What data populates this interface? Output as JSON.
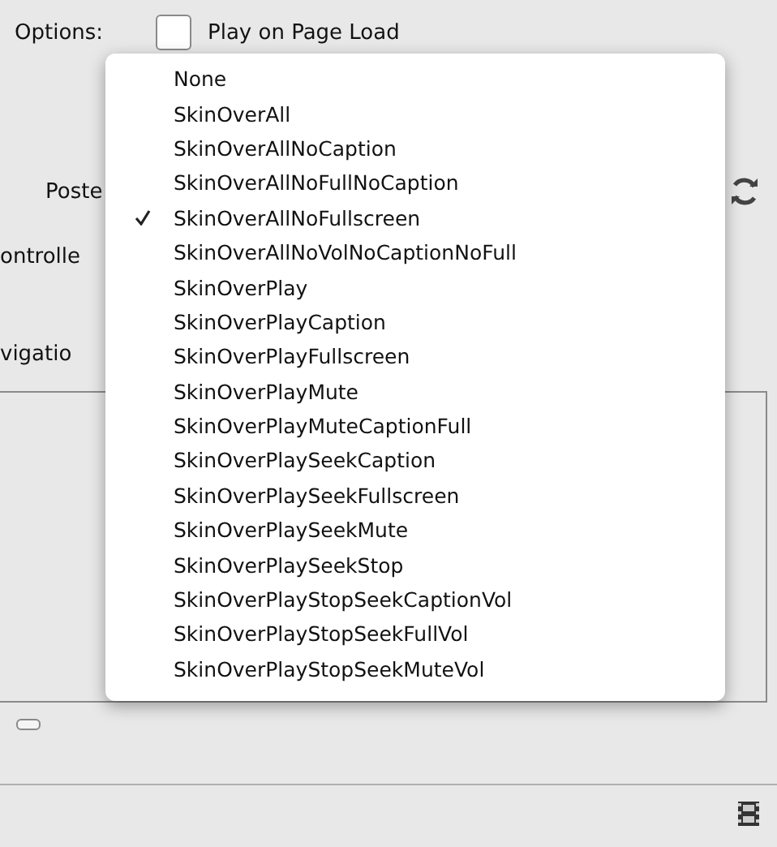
{
  "options": {
    "label": "Options:",
    "play_on_load": {
      "label": "Play on Page Load",
      "checked": false
    }
  },
  "side_labels": [
    {
      "text": "Poste",
      "kind": "poster"
    },
    {
      "text": "ontrolle",
      "kind": "controller"
    },
    {
      "text": "vigatio",
      "kind": "navigation"
    }
  ],
  "menu": {
    "items": [
      {
        "label": "None",
        "selected": false
      },
      {
        "label": "SkinOverAll",
        "selected": false
      },
      {
        "label": "SkinOverAllNoCaption",
        "selected": false
      },
      {
        "label": "SkinOverAllNoFullNoCaption",
        "selected": false
      },
      {
        "label": "SkinOverAllNoFullscreen",
        "selected": true
      },
      {
        "label": "SkinOverAllNoVolNoCaptionNoFull",
        "selected": false
      },
      {
        "label": "SkinOverPlay",
        "selected": false
      },
      {
        "label": "SkinOverPlayCaption",
        "selected": false
      },
      {
        "label": "SkinOverPlayFullscreen",
        "selected": false
      },
      {
        "label": "SkinOverPlayMute",
        "selected": false
      },
      {
        "label": "SkinOverPlayMuteCaptionFull",
        "selected": false
      },
      {
        "label": "SkinOverPlaySeekCaption",
        "selected": false
      },
      {
        "label": "SkinOverPlaySeekFullscreen",
        "selected": false
      },
      {
        "label": "SkinOverPlaySeekMute",
        "selected": false
      },
      {
        "label": "SkinOverPlaySeekStop",
        "selected": false
      },
      {
        "label": "SkinOverPlayStopSeekCaptionVol",
        "selected": false
      },
      {
        "label": "SkinOverPlayStopSeekFullVol",
        "selected": false
      },
      {
        "label": "SkinOverPlayStopSeekMuteVol",
        "selected": false
      }
    ]
  }
}
